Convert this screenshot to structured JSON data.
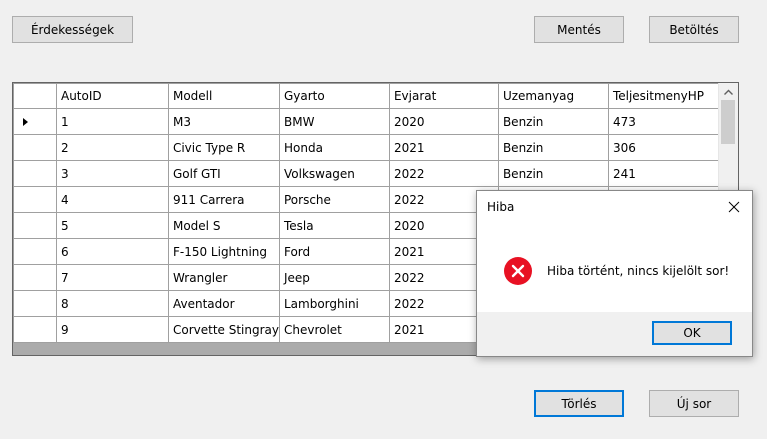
{
  "toolbar": {
    "properties_label": "Érdekességek",
    "save_label": "Mentés",
    "load_label": "Betöltés"
  },
  "grid": {
    "columns": [
      "AutoID",
      "Modell",
      "Gyarto",
      "Evjarat",
      "Uzemanyag",
      "TeljesitmenyHP"
    ],
    "rows": [
      [
        "1",
        "M3",
        "BMW",
        "2020",
        "Benzin",
        "473"
      ],
      [
        "2",
        "Civic Type R",
        "Honda",
        "2021",
        "Benzin",
        "306"
      ],
      [
        "3",
        "Golf GTI",
        "Volkswagen",
        "2022",
        "Benzin",
        "241"
      ],
      [
        "4",
        "911 Carrera",
        "Porsche",
        "2022",
        "",
        ""
      ],
      [
        "5",
        "Model S",
        "Tesla",
        "2020",
        "",
        ""
      ],
      [
        "6",
        "F-150 Lightning",
        "Ford",
        "2021",
        "",
        ""
      ],
      [
        "7",
        "Wrangler",
        "Jeep",
        "2022",
        "",
        ""
      ],
      [
        "8",
        "Aventador",
        "Lamborghini",
        "2022",
        "",
        ""
      ],
      [
        "9",
        "Corvette Stingray",
        "Chevrolet",
        "2021",
        "",
        ""
      ]
    ],
    "selected_row": 0
  },
  "bottom": {
    "delete_label": "Törlés",
    "new_row_label": "Új sor"
  },
  "dialog": {
    "title": "Hiba",
    "message": "Hiba történt, nincs kijelölt sor!",
    "ok_label": "OK"
  },
  "icons": {
    "error": "error-icon",
    "close": "close-icon",
    "scroll_up": "chevron-up-icon",
    "row_selector": "row-selector-icon"
  },
  "colors": {
    "error_red": "#e81123",
    "focus_blue": "#0078d7"
  }
}
